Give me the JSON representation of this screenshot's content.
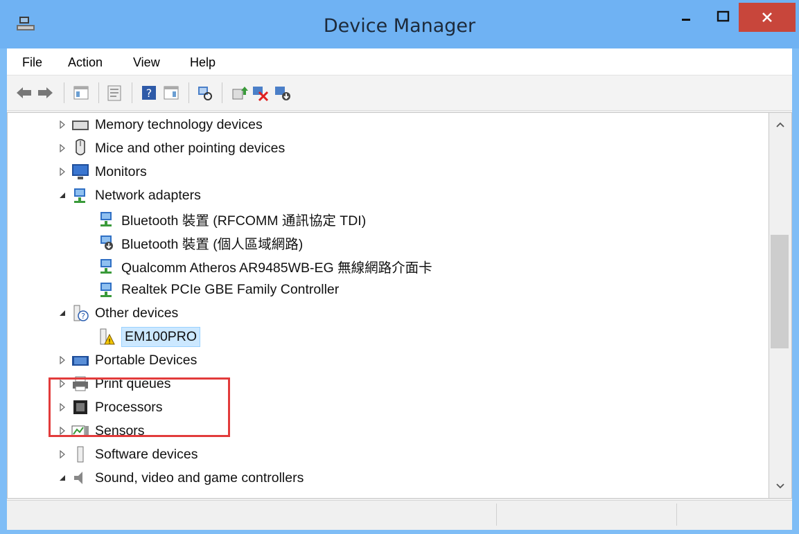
{
  "window": {
    "title": "Device Manager",
    "title_bar_color": "#6fb2f3",
    "close_color": "#c8463b"
  },
  "menu": {
    "items": [
      "File",
      "Action",
      "View",
      "Help"
    ]
  },
  "toolbar": {
    "buttons": [
      "back-arrow-icon",
      "forward-arrow-icon",
      "show-hide-tree-icon",
      "properties-icon",
      "help-icon",
      "action-pane-icon",
      "scan-hardware-icon",
      "update-driver-icon",
      "uninstall-icon",
      "enable-device-icon"
    ]
  },
  "tree": {
    "items": [
      {
        "label": "Memory technology devices",
        "expanded": false,
        "icon": "memory-card-icon"
      },
      {
        "label": "Mice and other pointing devices",
        "expanded": false,
        "icon": "mouse-icon"
      },
      {
        "label": "Monitors",
        "expanded": false,
        "icon": "monitor-icon"
      },
      {
        "label": "Network adapters",
        "expanded": true,
        "icon": "network-adapter-icon"
      },
      {
        "label": "Bluetooth 裝置 (RFCOMM 通訊協定 TDI)",
        "icon": "network-adapter-icon"
      },
      {
        "label": "Bluetooth 裝置 (個人區域網路)",
        "icon": "bluetooth-network-icon"
      },
      {
        "label": "Qualcomm Atheros AR9485WB-EG 無線網路介面卡",
        "icon": "network-adapter-icon"
      },
      {
        "label": "Realtek PCIe GBE Family Controller",
        "icon": "network-adapter-icon"
      },
      {
        "label": "Other devices",
        "expanded": true,
        "icon": "unknown-device-icon"
      },
      {
        "label": "EM100PRO",
        "selected": true,
        "icon": "warning-device-icon"
      },
      {
        "label": "Portable Devices",
        "expanded": false,
        "icon": "portable-device-icon"
      },
      {
        "label": "Print queues",
        "expanded": false,
        "icon": "printer-icon"
      },
      {
        "label": "Processors",
        "expanded": false,
        "icon": "processor-icon"
      },
      {
        "label": "Sensors",
        "expanded": false,
        "icon": "sensor-icon"
      },
      {
        "label": "Software devices",
        "expanded": false,
        "icon": "software-device-icon"
      },
      {
        "label": "Sound, video and game controllers",
        "expanded": true,
        "icon": "speaker-icon"
      }
    ]
  },
  "highlight_color": "#e23b3b"
}
